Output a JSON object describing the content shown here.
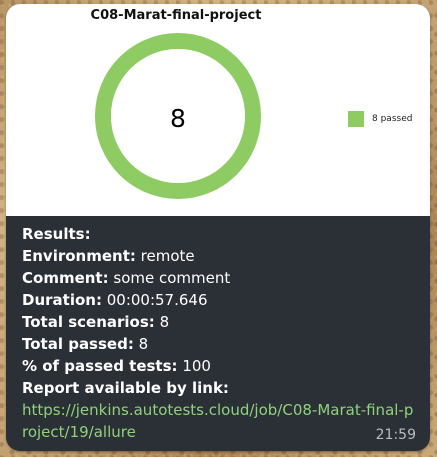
{
  "chart": {
    "title": "C08-Marat-final-project",
    "center_value": "8"
  },
  "chart_data": {
    "type": "pie",
    "title": "C08-Marat-final-project",
    "series": [
      {
        "name": "8 passed",
        "values": [
          8
        ]
      }
    ],
    "categories": [
      "passed"
    ],
    "center_label": "8",
    "legend": "right",
    "colors": [
      "#8fcb63"
    ]
  },
  "details": {
    "results_label": "Results:",
    "environment_label": "Environment:",
    "environment_value": "remote",
    "comment_label": "Comment:",
    "comment_value": "some comment",
    "duration_label": "Duration:",
    "duration_value": "00:00:57.646",
    "total_scenarios_label": "Total scenarios:",
    "total_scenarios_value": "8",
    "total_passed_label": "Total passed:",
    "total_passed_value": "8",
    "passed_percent_label": "% of passed tests:",
    "passed_percent_value": "100",
    "report_label": "Report available by link:",
    "report_link": "https://jenkins.autotests.cloud/job/C08-Marat-final-project/19/allure"
  },
  "time": "21:59",
  "colors": {
    "passed_green": "#8fcb63",
    "link_green": "#8fd27b",
    "bubble_dark": "#2b2f36",
    "chart_white": "#ffffff"
  }
}
